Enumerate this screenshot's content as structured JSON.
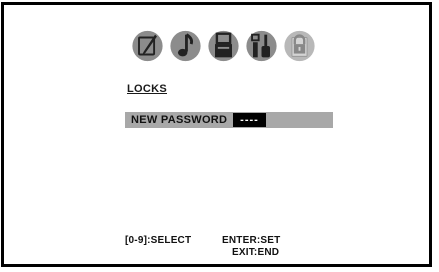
{
  "menu": {
    "tabs": [
      {
        "icon": "paintbrush-icon"
      },
      {
        "icon": "music-note-icon"
      },
      {
        "icon": "speaker-icon"
      },
      {
        "icon": "tools-icon"
      },
      {
        "icon": "padlock-icon"
      }
    ]
  },
  "section": {
    "title": "LOCKS"
  },
  "password": {
    "label": "NEW PASSWORD",
    "value": "----"
  },
  "hints": {
    "select": "[0-9]:SELECT",
    "set": "ENTER:SET",
    "end": "EXIT:END"
  },
  "colors": {
    "highlight_row": "#a8a8a8",
    "icon_gray": "#8a8a8a",
    "text": "#111111"
  }
}
